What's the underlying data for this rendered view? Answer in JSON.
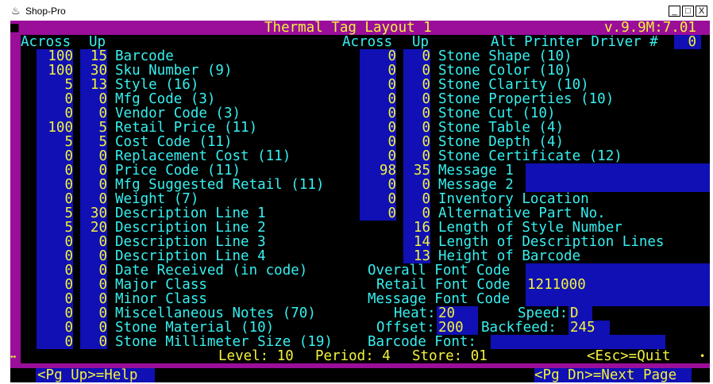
{
  "window": {
    "title": "Shop-Pro",
    "minimize": "_",
    "maximize": "□",
    "close": "X",
    "app_icon": "shop-pro-app-icon"
  },
  "header": {
    "title": "Thermal Tag Layout 1",
    "version": "v.9.9M:7.01"
  },
  "columns": {
    "across": "Across",
    "up": "Up",
    "alt_printer_label": "Alt Printer Driver #",
    "alt_printer_value": "0"
  },
  "left_rows": [
    {
      "across": "100",
      "up": "15",
      "label": "Barcode"
    },
    {
      "across": "100",
      "up": "30",
      "label": "Sku Number (9)"
    },
    {
      "across": "5",
      "up": "13",
      "label": "Style (16)"
    },
    {
      "across": "0",
      "up": "0",
      "label": "Mfg Code (3)"
    },
    {
      "across": "0",
      "up": "0",
      "label": "Vendor Code (3)"
    },
    {
      "across": "100",
      "up": "5",
      "label": "Retail Price (11)"
    },
    {
      "across": "5",
      "up": "5",
      "label": "Cost Code (11)"
    },
    {
      "across": "0",
      "up": "0",
      "label": "Replacement Cost (11)"
    },
    {
      "across": "0",
      "up": "0",
      "label": "Price Code (11)"
    },
    {
      "across": "0",
      "up": "0",
      "label": "Mfg Suggested Retail (11)"
    },
    {
      "across": "0",
      "up": "0",
      "label": "Weight (7)"
    },
    {
      "across": "5",
      "up": "30",
      "label": "Description Line 1"
    },
    {
      "across": "5",
      "up": "20",
      "label": "Description Line 2"
    },
    {
      "across": "0",
      "up": "0",
      "label": "Description Line 3"
    },
    {
      "across": "0",
      "up": "0",
      "label": "Description Line 4"
    },
    {
      "across": "0",
      "up": "0",
      "label": "Date Received (in code)"
    },
    {
      "across": "0",
      "up": "0",
      "label": "Major Class"
    },
    {
      "across": "0",
      "up": "0",
      "label": "Minor Class"
    },
    {
      "across": "0",
      "up": "0",
      "label": "Miscellaneous Notes (70)"
    },
    {
      "across": "0",
      "up": "0",
      "label": "Stone Material (10)"
    },
    {
      "across": "0",
      "up": "0",
      "label": "Stone Millimeter Size (19)"
    }
  ],
  "right_rows": [
    {
      "across": "0",
      "up": "0",
      "label": "Stone Shape (10)"
    },
    {
      "across": "0",
      "up": "0",
      "label": "Stone Color (10)"
    },
    {
      "across": "0",
      "up": "0",
      "label": "Stone Clarity (10)"
    },
    {
      "across": "0",
      "up": "0",
      "label": "Stone Properties (10)"
    },
    {
      "across": "0",
      "up": "0",
      "label": "Stone Cut (10)"
    },
    {
      "across": "0",
      "up": "0",
      "label": "Stone Table (4)"
    },
    {
      "across": "0",
      "up": "0",
      "label": "Stone Depth (4)"
    },
    {
      "across": "0",
      "up": "0",
      "label": "Stone Certificate (12)"
    },
    {
      "across": "98",
      "up": "35",
      "label": "Message 1",
      "value": ""
    },
    {
      "across": "0",
      "up": "0",
      "label": "Message 2",
      "value": ""
    },
    {
      "across": "0",
      "up": "0",
      "label": "Inventory Location"
    },
    {
      "across": "0",
      "up": "0",
      "label": "Alternative Part No."
    }
  ],
  "lengths": [
    {
      "value": "16",
      "label": "Length of Style Number"
    },
    {
      "value": "14",
      "label": "Length of Description Lines"
    },
    {
      "value": "13",
      "label": "Height of Barcode"
    }
  ],
  "fonts": {
    "overall_label": "Overall Font Code",
    "overall_value": "",
    "retail_label": "Retail Font Code",
    "retail_value": "1211000",
    "message_label": "Message Font Code",
    "message_value": ""
  },
  "printer": {
    "heat_label": "Heat:",
    "heat_value": "20",
    "speed_label": "Speed:",
    "speed_value": "D",
    "offset_label": "Offset:",
    "offset_value": "200",
    "backfeed_label": "Backfeed:",
    "backfeed_value": "245",
    "barcode_font_label": "Barcode Font:",
    "barcode_font_value": ""
  },
  "status": {
    "level": "Level: 10",
    "period": "Period: 4",
    "store": "Store: 01",
    "quit": "<Esc>=Quit"
  },
  "footer": {
    "help": "<Pg Up>=Help",
    "next": "<Pg Dn>=Next Page"
  },
  "colors": {
    "frame": "#9a0e9a",
    "field": "#1010b4",
    "label": "#36f0f0",
    "value": "#f2f23c"
  }
}
